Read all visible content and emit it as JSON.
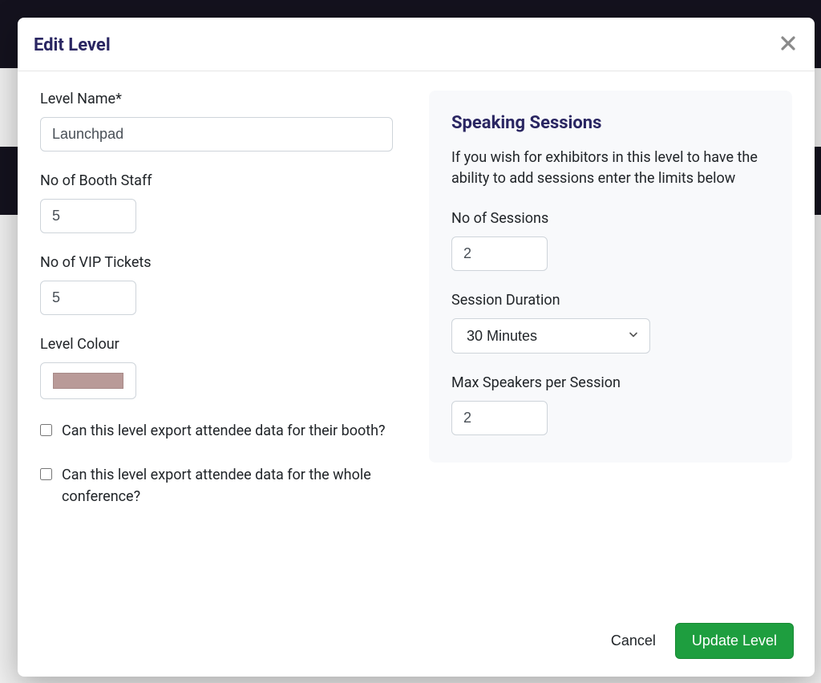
{
  "modal": {
    "title": "Edit Level",
    "close_icon": "close-icon"
  },
  "left": {
    "level_name_label": "Level Name*",
    "level_name_value": "Launchpad",
    "booth_staff_label": "No of Booth Staff",
    "booth_staff_value": "5",
    "vip_tickets_label": "No of VIP Tickets",
    "vip_tickets_value": "5",
    "level_colour_label": "Level Colour",
    "level_colour_value": "#b99a98",
    "checkbox_booth_label": "Can this level export attendee data for their booth?",
    "checkbox_conference_label": "Can this level export attendee data for the whole conference?"
  },
  "right": {
    "panel_title": "Speaking Sessions",
    "panel_desc": "If you wish for exhibitors in this level to have the ability to add sessions enter the limits below",
    "sessions_label": "No of Sessions",
    "sessions_value": "2",
    "duration_label": "Session Duration",
    "duration_value": "30 Minutes",
    "max_speakers_label": "Max Speakers per Session",
    "max_speakers_value": "2"
  },
  "footer": {
    "cancel_label": "Cancel",
    "update_label": "Update Level"
  }
}
